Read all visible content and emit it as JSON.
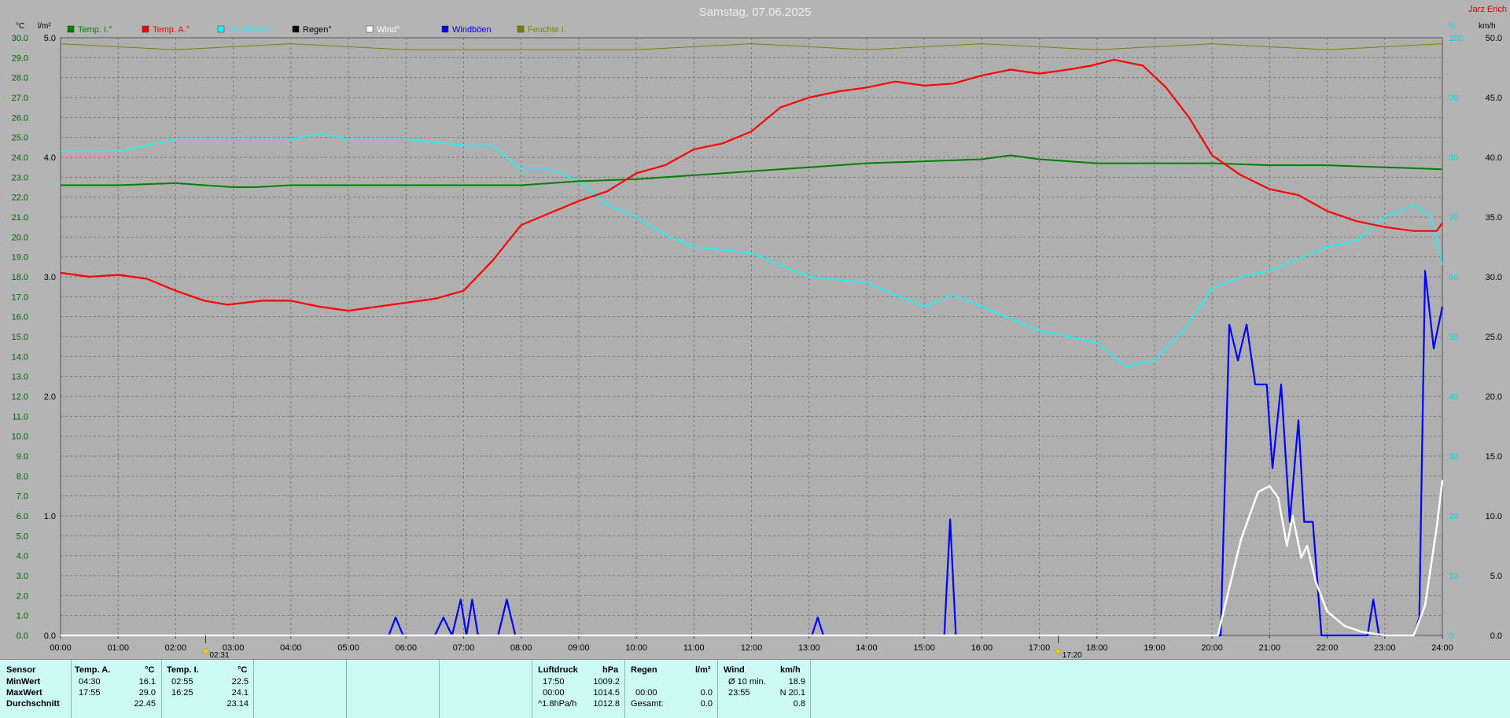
{
  "chart_data": {
    "type": "line",
    "title": "Samstag, 07.06.2025",
    "corner_label": "Jarz Erich",
    "left_axis_unit": "°C",
    "rain_axis_unit": "l/m²",
    "right_axis_unit": "km/h",
    "right_inner_unit": "%",
    "x_ticks": [
      "00:00",
      "01:00",
      "02:00",
      "03:00",
      "04:00",
      "05:00",
      "06:00",
      "07:00",
      "08:00",
      "09:00",
      "10:00",
      "11:00",
      "12:00",
      "13:00",
      "14:00",
      "15:00",
      "16:00",
      "17:00",
      "18:00",
      "19:00",
      "20:00",
      "21:00",
      "22:00",
      "23:00",
      "24:00"
    ],
    "temp_ticks": [
      "0.0",
      "1.0",
      "2.0",
      "3.0",
      "4.0",
      "5.0",
      "6.0",
      "7.0",
      "8.0",
      "9.0",
      "10.0",
      "11.0",
      "12.0",
      "13.0",
      "14.0",
      "15.0",
      "16.0",
      "17.0",
      "18.0",
      "19.0",
      "20.0",
      "21.0",
      "22.0",
      "23.0",
      "24.0",
      "25.0",
      "26.0",
      "27.0",
      "28.0",
      "29.0",
      "30.0"
    ],
    "rain_ticks": [
      "0.0",
      "1.0",
      "2.0",
      "3.0",
      "4.0",
      "5.0"
    ],
    "wind_ticks": [
      "0.0",
      "5.0",
      "10.0",
      "15.0",
      "20.0",
      "25.0",
      "30.0",
      "35.0",
      "40.0",
      "45.0",
      "50.0"
    ],
    "humidity_ticks": [
      "0",
      "10",
      "20",
      "30",
      "40",
      "50",
      "60",
      "70",
      "80",
      "90",
      "100"
    ],
    "ylim_temp": [
      0,
      30
    ],
    "ylim_rain": [
      0,
      5
    ],
    "ylim_wind": [
      0,
      50
    ],
    "ylim_humidity": [
      0,
      100
    ],
    "xlim_hours": [
      0,
      24
    ],
    "grid": true,
    "legend_position": "top",
    "legend": [
      {
        "label": "Temp. I.°",
        "color": "#008000"
      },
      {
        "label": "Temp. A.°",
        "color": "#ff0000"
      },
      {
        "label": "Feuchte A.°",
        "color": "#00ffff"
      },
      {
        "label": "Regen°",
        "color": "#000000"
      },
      {
        "label": "Wind°",
        "color": "#ffffff"
      },
      {
        "label": "Windböen",
        "color": "#0000ff"
      },
      {
        "label": "Feuchte I.",
        "color": "#808000"
      }
    ],
    "markers": [
      {
        "time": "02:31",
        "hour": 2.52,
        "icon": "sunrise-icon"
      },
      {
        "time": "17:20",
        "hour": 17.33,
        "icon": "sunset-icon"
      }
    ],
    "series": [
      {
        "name": "Temp. I.°",
        "axis": "temp",
        "color": "#008000",
        "x": [
          0,
          1,
          2,
          2.5,
          3,
          3.4,
          4,
          5,
          6,
          7,
          8,
          9,
          10,
          11,
          12,
          13,
          14,
          15,
          16,
          16.5,
          17,
          18,
          19,
          20,
          21,
          22,
          23,
          24
        ],
        "y": [
          22.6,
          22.6,
          22.7,
          22.6,
          22.5,
          22.5,
          22.6,
          22.6,
          22.6,
          22.6,
          22.6,
          22.8,
          22.9,
          23.1,
          23.3,
          23.5,
          23.7,
          23.8,
          23.9,
          24.1,
          23.9,
          23.7,
          23.7,
          23.7,
          23.6,
          23.6,
          23.5,
          23.4
        ]
      },
      {
        "name": "Temp. A.°",
        "axis": "temp",
        "color": "#ff0000",
        "x": [
          0,
          0.5,
          1,
          1.5,
          2,
          2.5,
          2.9,
          3.5,
          4,
          4.5,
          5,
          5.5,
          6,
          6.5,
          7,
          7.5,
          8,
          8.5,
          9,
          9.5,
          10,
          10.5,
          11,
          11.5,
          12,
          12.5,
          13,
          13.5,
          14,
          14.5,
          15,
          15.5,
          16,
          16.5,
          17,
          17.5,
          17.9,
          18.3,
          18.8,
          19.2,
          19.6,
          20,
          20.5,
          21,
          21.5,
          22,
          22.5,
          23,
          23.5,
          23.9,
          24
        ],
        "y": [
          18.2,
          18.0,
          18.1,
          17.9,
          17.3,
          16.8,
          16.6,
          16.8,
          16.8,
          16.5,
          16.3,
          16.5,
          16.7,
          16.9,
          17.3,
          18.8,
          20.6,
          21.2,
          21.8,
          22.3,
          23.2,
          23.6,
          24.4,
          24.7,
          25.3,
          26.5,
          27.0,
          27.3,
          27.5,
          27.8,
          27.6,
          27.7,
          28.1,
          28.4,
          28.2,
          28.4,
          28.6,
          28.9,
          28.6,
          27.5,
          26.0,
          24.1,
          23.1,
          22.4,
          22.1,
          21.3,
          20.8,
          20.5,
          20.3,
          20.3,
          20.7
        ]
      },
      {
        "name": "Feuchte A.°",
        "axis": "humidity",
        "color": "#00ffff",
        "x": [
          0,
          1,
          2,
          3,
          4,
          4.5,
          5,
          6,
          7,
          7.5,
          8,
          8.5,
          9,
          9.5,
          10,
          10.5,
          11,
          12,
          13,
          14,
          15,
          15.5,
          16,
          17,
          17.5,
          18,
          18.5,
          19,
          19.5,
          20,
          20.5,
          21,
          21.5,
          22,
          22.5,
          23,
          23.5,
          23.8,
          24
        ],
        "y": [
          81,
          81,
          83,
          83,
          83,
          84,
          83,
          83,
          82,
          82,
          78,
          78,
          76,
          72,
          70,
          67,
          65,
          64,
          60,
          59,
          55,
          57,
          55,
          51,
          50,
          49,
          45,
          46,
          51,
          58,
          60,
          61,
          63,
          65,
          66,
          70,
          72,
          70,
          62
        ]
      },
      {
        "name": "Feuchte I.",
        "axis": "humidity",
        "color": "#808000",
        "x": [
          0,
          2,
          4,
          6,
          7,
          8,
          10,
          12,
          14,
          16,
          18,
          20,
          22,
          24
        ],
        "y": [
          99,
          98,
          99,
          98,
          98,
          98,
          98,
          99,
          98,
          99,
          98,
          99,
          98,
          99
        ]
      },
      {
        "name": "Wind°",
        "axis": "wind",
        "color": "#ffffff",
        "x": [
          0,
          20.1,
          20.3,
          20.5,
          20.8,
          21,
          21.15,
          21.3,
          21.4,
          21.55,
          21.65,
          21.8,
          22,
          22.3,
          22.6,
          23,
          23.5,
          23.7,
          23.9,
          24
        ],
        "y": [
          0,
          0,
          4,
          8,
          12,
          12.5,
          11.5,
          7.5,
          10,
          6.5,
          7.5,
          4.5,
          2,
          0.8,
          0.3,
          0,
          0,
          2.5,
          9,
          13
        ]
      },
      {
        "name": "Windböen",
        "axis": "wind",
        "color": "#0000ff",
        "x": [
          0,
          5.7,
          5.82,
          5.95,
          6.5,
          6.65,
          6.8,
          6.95,
          7.05,
          7.15,
          7.25,
          7.6,
          7.75,
          7.9,
          8.0,
          13.05,
          13.15,
          13.25,
          15.35,
          15.45,
          15.55,
          20.15,
          20.3,
          20.45,
          20.6,
          20.75,
          20.95,
          21.05,
          21.2,
          21.35,
          21.5,
          21.6,
          21.75,
          21.9,
          22.0,
          22.7,
          22.8,
          22.9,
          23.5,
          23.6,
          23.7,
          23.85,
          24
        ],
        "y": [
          0,
          0,
          1.5,
          0,
          0,
          1.5,
          0,
          3,
          0,
          3,
          0,
          0,
          3,
          0,
          0,
          0,
          1.5,
          0,
          0,
          9.7,
          0,
          0,
          26,
          23,
          26,
          21,
          21,
          14,
          21,
          9.5,
          18,
          9.5,
          9.5,
          0,
          0,
          0,
          3,
          0,
          0,
          1.5,
          30.5,
          24,
          27.5
        ]
      }
    ]
  },
  "stats": {
    "headers": {
      "sensor": "Sensor",
      "temp_a": "Temp. A.",
      "temp_a_unit": "°C",
      "temp_i": "Temp. I.",
      "temp_i_unit": "°C",
      "pressure": "Luftdruck",
      "pressure_unit": "hPa",
      "rain": "Regen",
      "rain_unit": "l/m²",
      "wind": "Wind",
      "wind_unit": "km/h"
    },
    "rows": {
      "min_label": "MinWert",
      "max_label": "MaxWert",
      "avg_label": "Durchschnitt"
    },
    "temp_a": {
      "min_time": "04:30",
      "min": "16.1",
      "max_time": "17:55",
      "max": "29.0",
      "avg": "22.45"
    },
    "temp_i": {
      "min_time": "02:55",
      "min": "22.5",
      "max_time": "16:25",
      "max": "24.1",
      "avg": "23.14"
    },
    "pressure": {
      "min_time": "17:50",
      "min": "1009.2",
      "max_time": "00:00",
      "max": "1014.5",
      "trend": "^1.8hPa/h",
      "trend_value": "1012.8"
    },
    "rain": {
      "max_time": "00:00",
      "max": "0.0",
      "total_label": "Gesamt:",
      "total": "0.0"
    },
    "wind": {
      "avg_label": "Ø 10 min.",
      "avg": "18.9",
      "max_time": "23:55",
      "max": "N 20.1",
      "mean": "0.8"
    }
  }
}
